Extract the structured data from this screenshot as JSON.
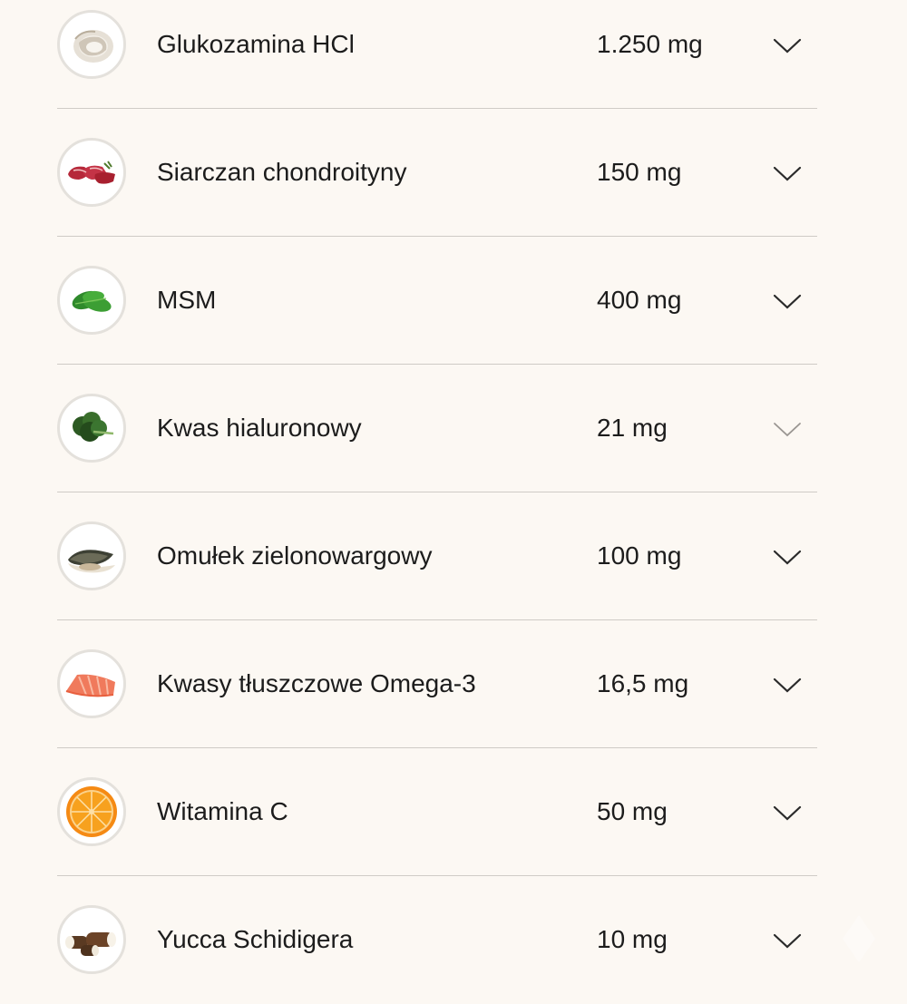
{
  "ingredients": [
    {
      "name": "Glukozamina HCl",
      "amount": "1.250 mg",
      "icon": "oyster-icon"
    },
    {
      "name": "Siarczan chondroityny",
      "amount": "150 mg",
      "icon": "raw-beef-icon"
    },
    {
      "name": "MSM",
      "amount": "400 mg",
      "icon": "spinach-icon"
    },
    {
      "name": "Kwas hialuronowy",
      "amount": "21 mg",
      "icon": "kale-icon"
    },
    {
      "name": "Omułek zielonowargowy",
      "amount": "100 mg",
      "icon": "mussel-icon"
    },
    {
      "name": "Kwasy tłuszczowe Omega-3",
      "amount": "16,5 mg",
      "icon": "salmon-icon"
    },
    {
      "name": "Witamina C",
      "amount": "50 mg",
      "icon": "orange-slice-icon"
    },
    {
      "name": "Yucca Schidigera",
      "amount": "10 mg",
      "icon": "yucca-root-icon"
    }
  ],
  "colors": {
    "background": "#fcf8f3",
    "divider": "#cfcbc6",
    "text": "#1c1c1c"
  }
}
